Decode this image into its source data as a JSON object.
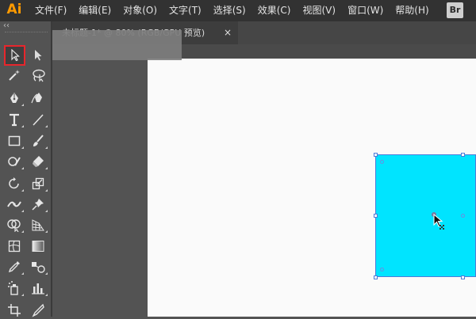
{
  "app": {
    "logo": "Ai"
  },
  "menu": [
    {
      "label": "文件(F)"
    },
    {
      "label": "编辑(E)"
    },
    {
      "label": "对象(O)"
    },
    {
      "label": "文字(T)"
    },
    {
      "label": "选择(S)"
    },
    {
      "label": "效果(C)"
    },
    {
      "label": "视图(V)"
    },
    {
      "label": "窗口(W)"
    },
    {
      "label": "帮助(H)"
    }
  ],
  "bridge_button": {
    "label": "Br"
  },
  "tools_panel": {
    "collapse_label": "‹‹"
  },
  "document_tab": {
    "title": "未标题-1* @ 80% (RGB/GPU 预览)",
    "close_label": "×"
  },
  "tools": [
    {
      "name": "selection-tool",
      "icon": "arrow-icon"
    },
    {
      "name": "direct-selection-tool",
      "icon": "hollow-arrow-icon"
    },
    {
      "name": "magic-wand-tool",
      "icon": "magic-wand-icon"
    },
    {
      "name": "lasso-tool",
      "icon": "lasso-icon"
    },
    {
      "name": "pen-tool",
      "icon": "pen-icon"
    },
    {
      "name": "curvature-tool",
      "icon": "curvature-pen-icon"
    },
    {
      "name": "type-tool",
      "icon": "type-icon"
    },
    {
      "name": "line-segment-tool",
      "icon": "line-icon"
    },
    {
      "name": "rectangle-tool",
      "icon": "rectangle-icon"
    },
    {
      "name": "paintbrush-tool",
      "icon": "brush-icon"
    },
    {
      "name": "shaper-tool",
      "icon": "shaper-icon"
    },
    {
      "name": "eraser-tool",
      "icon": "eraser-icon"
    },
    {
      "name": "rotate-tool",
      "icon": "rotate-icon"
    },
    {
      "name": "scale-tool",
      "icon": "scale-icon"
    },
    {
      "name": "width-tool",
      "icon": "width-icon"
    },
    {
      "name": "puppet-warp-tool",
      "icon": "pin-icon"
    },
    {
      "name": "shape-builder-tool",
      "icon": "shape-builder-icon"
    },
    {
      "name": "perspective-grid-tool",
      "icon": "perspective-icon"
    },
    {
      "name": "mesh-tool",
      "icon": "mesh-icon"
    },
    {
      "name": "gradient-tool",
      "icon": "gradient-icon"
    },
    {
      "name": "eyedropper-tool",
      "icon": "eyedropper-icon"
    },
    {
      "name": "blend-tool",
      "icon": "blend-icon"
    },
    {
      "name": "symbol-sprayer-tool",
      "icon": "symbol-sprayer-icon"
    },
    {
      "name": "column-graph-tool",
      "icon": "column-graph-icon"
    },
    {
      "name": "artboard-tool",
      "icon": "artboard-icon"
    },
    {
      "name": "slice-tool",
      "icon": "slice-icon"
    }
  ],
  "colors": {
    "menubar": "#323232",
    "panel": "#535353",
    "artboard": "#fafafa",
    "shape_fill": "#00e4ff",
    "selection": "#4d7bd8",
    "active_tool_outline": "#e8262c",
    "logo": "#ff9a00"
  }
}
